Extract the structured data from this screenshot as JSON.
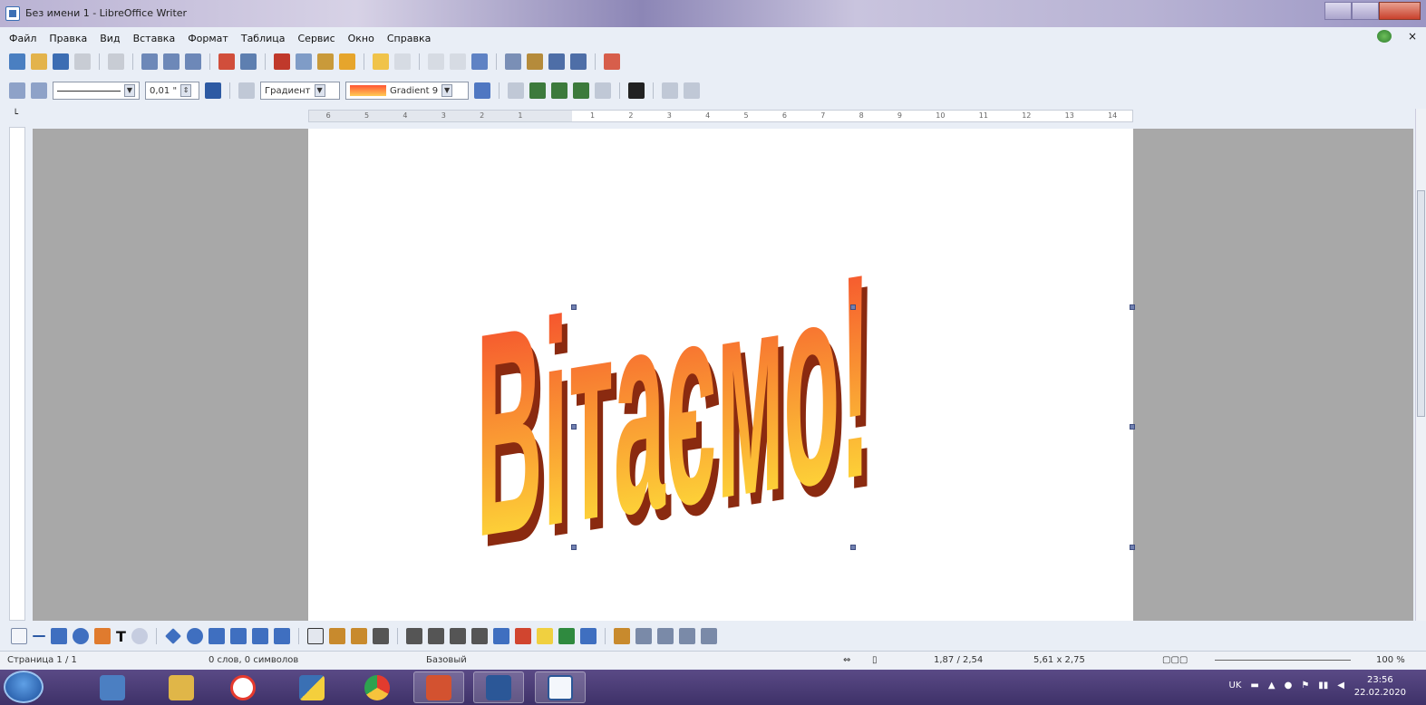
{
  "window": {
    "title": "Без имени 1 - LibreOffice Writer"
  },
  "menu": [
    "Файл",
    "Правка",
    "Вид",
    "Вставка",
    "Формат",
    "Таблица",
    "Сервис",
    "Окно",
    "Справка"
  ],
  "format_bar": {
    "line_width": "0,01 \"",
    "area_style": "Градиент",
    "gradient_name": "Gradient 9"
  },
  "ruler_labels": [
    "6",
    "5",
    "4",
    "3",
    "2",
    "1",
    "",
    "1",
    "2",
    "3",
    "4",
    "5",
    "6",
    "7",
    "8",
    "9",
    "10",
    "11",
    "12",
    "13",
    "14"
  ],
  "document": {
    "fontwork_text": "Вітаємо!",
    "colors": {
      "gradient_top": "#f43a2c",
      "gradient_bottom": "#fff33a",
      "extrusion": "#8a2a10"
    }
  },
  "status": {
    "page": "Страница 1 / 1",
    "words": "0 слов, 0 символов",
    "style": "Базовый",
    "position": "1,87 / 2,54",
    "size": "5,61 x 2,75",
    "zoom": "100 %"
  },
  "taskbar": {
    "apps": [
      "windows-explorer",
      "file-manager",
      "yandex-browser",
      "python",
      "chrome",
      "powerpoint",
      "word",
      "libreoffice-writer"
    ],
    "tray_lang": "UK",
    "time": "23:56",
    "date": "22.02.2020"
  }
}
